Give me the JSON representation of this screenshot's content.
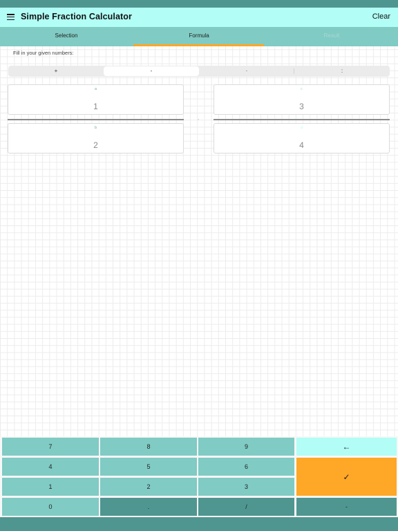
{
  "app": {
    "title": "Simple Fraction Calculator",
    "clear_label": "Clear",
    "menu_icon": "hamburger-menu-icon"
  },
  "colors": {
    "status_bar": "#4f9690",
    "app_bar": "#b2fef6",
    "tab_bar": "#80cbc4",
    "tab_indicator": "#ffa726",
    "key_primary": "#80cbc4",
    "key_secondary": "#4f9690",
    "key_backspace": "#b2fef6",
    "key_confirm": "#ffa726"
  },
  "tabs": [
    {
      "label": "Selection",
      "state": "normal"
    },
    {
      "label": "Formula",
      "state": "active"
    },
    {
      "label": "Result",
      "state": "disabled"
    }
  ],
  "formula": {
    "instruction": "Fill in your given numbers:",
    "operations": [
      {
        "label": "+",
        "selected": false
      },
      {
        "label": "-",
        "selected": true
      },
      {
        "label": "·",
        "selected": false
      },
      {
        "label": ":",
        "selected": false
      }
    ],
    "operator_display": "-",
    "fields": {
      "a": {
        "label": "a",
        "value": "1"
      },
      "b": {
        "label": "b",
        "value": "2"
      },
      "c": {
        "label": "c",
        "value": "3"
      },
      "d": {
        "label": "d",
        "value": "4"
      }
    }
  },
  "keypad": {
    "keys": [
      {
        "label": "7",
        "name": "key-7"
      },
      {
        "label": "8",
        "name": "key-8"
      },
      {
        "label": "9",
        "name": "key-9"
      },
      {
        "label": "4",
        "name": "key-4"
      },
      {
        "label": "5",
        "name": "key-5"
      },
      {
        "label": "6",
        "name": "key-6"
      },
      {
        "label": "1",
        "name": "key-1"
      },
      {
        "label": "2",
        "name": "key-2"
      },
      {
        "label": "3",
        "name": "key-3"
      },
      {
        "label": "0",
        "name": "key-0"
      },
      {
        "label": ".",
        "name": "key-decimal"
      },
      {
        "label": "/",
        "name": "key-slash"
      },
      {
        "label": "-",
        "name": "key-minus"
      }
    ],
    "backspace_icon": "←",
    "confirm_icon": "✓"
  }
}
